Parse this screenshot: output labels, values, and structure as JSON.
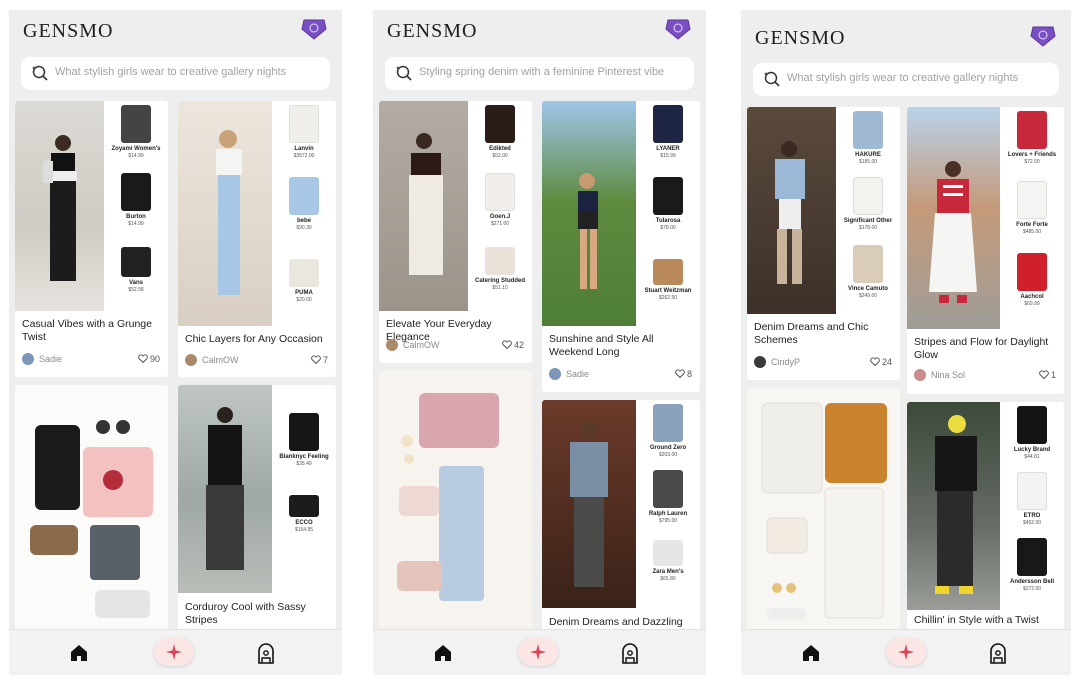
{
  "app": {
    "logo": "GENSMO"
  },
  "colors": {
    "badge": "#7a4fc4",
    "accent": "#d9475b",
    "background": "#eeeeee"
  },
  "icons": {
    "search": "search-sparkle-icon",
    "home": "home-icon",
    "sparkle": "sparkle-icon",
    "closet": "closet-icon",
    "heart": "heart-icon",
    "badge": "shield-badge-icon"
  },
  "screens": [
    {
      "search_placeholder": "What stylish girls wear to creative gallery nights",
      "cards": [
        {
          "title": "Casual Vibes with a Grunge Twist",
          "user": "Sadie",
          "likes": "90",
          "products": [
            {
              "name": "Zoyami Women's",
              "price": "$14.99"
            },
            {
              "name": "Burton",
              "price": "$14.99"
            },
            {
              "name": "Vans",
              "price": "$52.58"
            }
          ]
        },
        {
          "title": "Chic Layers for Any Occasion",
          "user": "CalmOW",
          "likes": "7",
          "products": [
            {
              "name": "Lanvin",
              "price": "$3572.00"
            },
            {
              "name": "bebe",
              "price": "$90.30"
            },
            {
              "name": "PUMA",
              "price": "$20.00"
            }
          ]
        },
        {
          "title": "",
          "user": "",
          "likes": "",
          "products": []
        },
        {
          "title": "Corduroy Cool with Sassy Stripes",
          "user": "",
          "likes": "",
          "products": [
            {
              "name": "Blanknyc Feeling",
              "price": "$35.49"
            },
            {
              "name": "ECCO",
              "price": "$154.95"
            }
          ]
        }
      ]
    },
    {
      "search_placeholder": "Styling spring denim with a feminine Pinterest vibe",
      "cards": [
        {
          "title": "Elevate Your Everyday Elegance",
          "user": "CalmOW",
          "likes": "42",
          "products": [
            {
              "name": "Edikted",
              "price": "$52.00"
            },
            {
              "name": "Goen.J",
              "price": "$271.00"
            },
            {
              "name": "Catering Studded",
              "price": "$51.10"
            }
          ]
        },
        {
          "title": "Sunshine and Style All Weekend Long",
          "user": "Sadie",
          "likes": "8",
          "products": [
            {
              "name": "LYANER",
              "price": "$15.99"
            },
            {
              "name": "Tularosa",
              "price": "$78.00"
            },
            {
              "name": "Stuart Weitzman",
              "price": "$262.50"
            }
          ]
        },
        {
          "title": "",
          "user": "",
          "likes": "",
          "products": []
        },
        {
          "title": "Denim Dreams and Dazzling",
          "user": "",
          "likes": "",
          "products": [
            {
              "name": "Ground Zero",
              "price": "$203.00"
            },
            {
              "name": "Ralph Lauren",
              "price": "$795.00"
            },
            {
              "name": "Zara Men's",
              "price": "$65.80"
            }
          ]
        }
      ]
    },
    {
      "search_placeholder": "What stylish girls wear to creative gallery nights",
      "cards": [
        {
          "title": "Denim Dreams and Chic Schemes",
          "user": "CindyP",
          "likes": "24",
          "products": [
            {
              "name": "HAKURE",
              "price": "$185.00"
            },
            {
              "name": "Significant Other",
              "price": "$178.00"
            },
            {
              "name": "Vince Camuto",
              "price": "$249.00"
            }
          ]
        },
        {
          "title": "Stripes and Flow for Daylight Glow",
          "user": "Nina Sol",
          "likes": "1",
          "products": [
            {
              "name": "Lovers + Friends",
              "price": "$72.00"
            },
            {
              "name": "Forte Forte",
              "price": "$485.00"
            },
            {
              "name": "Aachcol",
              "price": "$69.99"
            }
          ]
        },
        {
          "title": "",
          "user": "",
          "likes": "",
          "products": []
        },
        {
          "title": "Chillin' in Style with a Twist",
          "user": "",
          "likes": "",
          "products": [
            {
              "name": "Lucky Brand",
              "price": "$44.81"
            },
            {
              "name": "ETRO",
              "price": "$452.00"
            },
            {
              "name": "Andersson Bell",
              "price": "$272.00"
            }
          ]
        }
      ]
    }
  ]
}
